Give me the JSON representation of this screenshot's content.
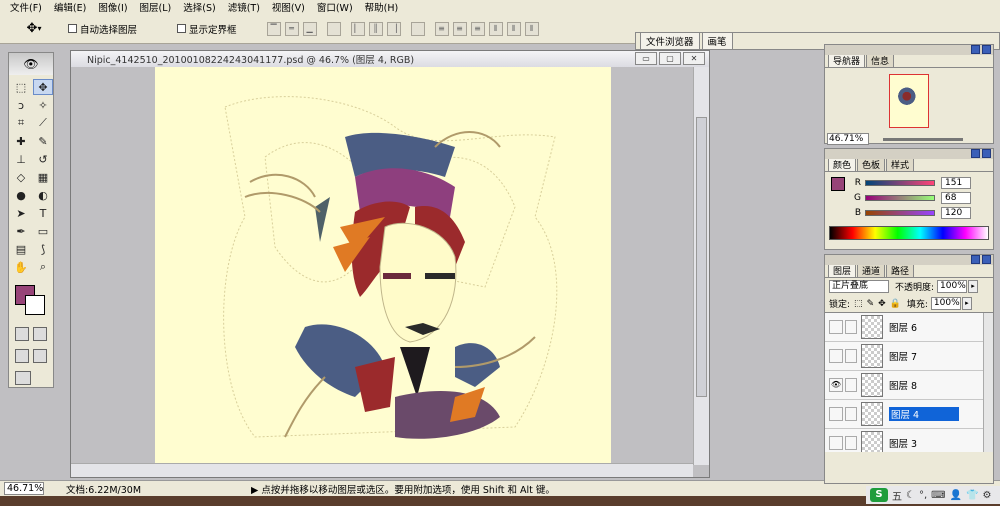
{
  "menu": [
    "文件(F)",
    "编辑(E)",
    "图像(I)",
    "图层(L)",
    "选择(S)",
    "滤镜(T)",
    "视图(V)",
    "窗口(W)",
    "帮助(H)"
  ],
  "options": {
    "auto_select_label": "自动选择图层",
    "show_bounds_label": "显示定界框"
  },
  "well_tabs": [
    "文件浏览器",
    "画笔"
  ],
  "document": {
    "title": "Nipic_4142510_20100108224243041177.psd @ 46.7% (图层 4, RGB)",
    "btn_min": "▭",
    "btn_max": "▢",
    "btn_close": "✕"
  },
  "status": {
    "zoom": "46.71%",
    "doc_size": "文档:6.22M/30M",
    "tip": "▶  点按并拖移以移动图层或选区。要用附加选项，使用 Shift 和 Alt 键。"
  },
  "navigator": {
    "tabs": [
      "导航器",
      "信息"
    ],
    "zoom": "46.71%"
  },
  "color": {
    "tabs": [
      "颜色",
      "色板",
      "样式"
    ],
    "r_label": "R",
    "r": "151",
    "g_label": "G",
    "g": "68",
    "b_label": "B",
    "b": "120",
    "fg_hex": "#974478"
  },
  "layers_panel": {
    "tabs": [
      "图层",
      "通道",
      "路径"
    ],
    "blend_mode": "正片叠底",
    "opacity_label": "不透明度:",
    "opacity": "100%",
    "lock_label": "锁定:",
    "fill_label": "填充:",
    "fill": "100%",
    "layers": [
      {
        "name": "图层 6",
        "visible": false
      },
      {
        "name": "图层 7",
        "visible": false
      },
      {
        "name": "图层 8",
        "visible": true
      },
      {
        "name": "图层 4",
        "visible": false,
        "selected": true
      },
      {
        "name": "图层 3",
        "visible": false
      }
    ]
  },
  "taskbar": {
    "badge": "S",
    "ime": "五"
  }
}
